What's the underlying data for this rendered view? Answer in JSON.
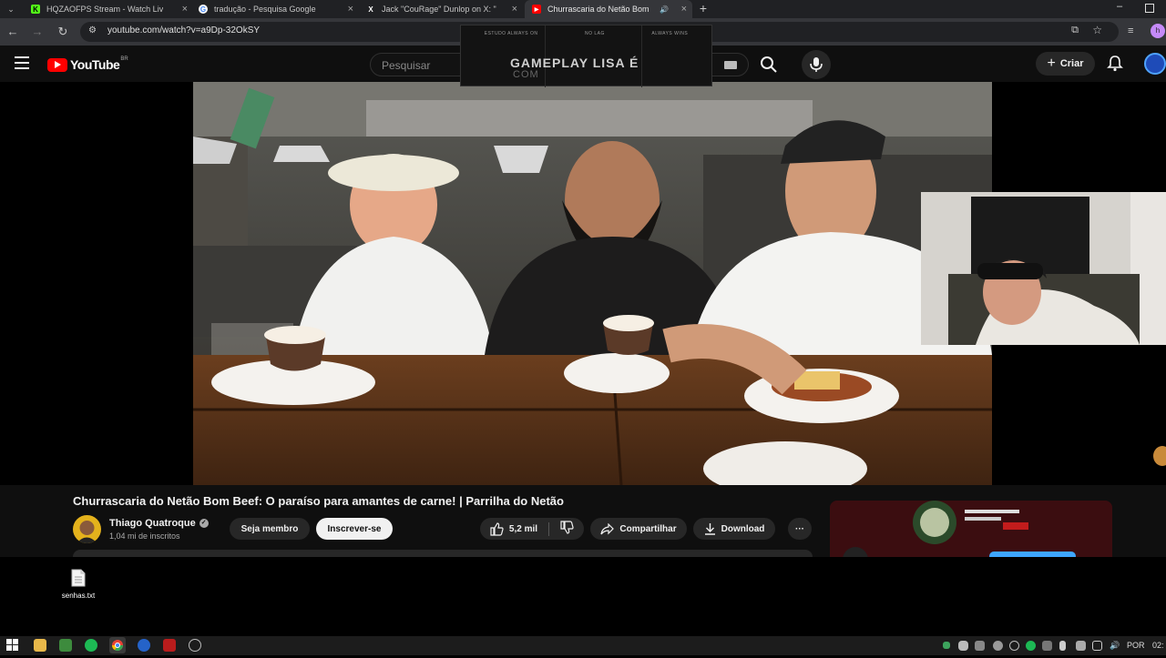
{
  "browser": {
    "tabs": [
      {
        "title": "HQZAOFPS Stream - Watch Liv",
        "icon": "kick-icon",
        "color": "#53fc18",
        "glyph": "K"
      },
      {
        "title": "tradução - Pesquisa Google",
        "icon": "google-icon",
        "color": "#ffffff",
        "glyph": "G"
      },
      {
        "title": "Jack \"CouRage\" Dunlop on X: \"",
        "icon": "x-icon",
        "color": "#ffffff",
        "glyph": "X"
      },
      {
        "title": "Churrascaria do Netão Bom",
        "icon": "youtube-icon",
        "color": "#ff0000",
        "glyph": "▶",
        "active": true
      }
    ],
    "url": "youtube.com/watch?v=a9Dp-32OkSY"
  },
  "youtube": {
    "logo_text": "YouTube",
    "region": "BR",
    "search_placeholder": "Pesquisar",
    "create_label": "Criar"
  },
  "overlay": {
    "columns": [
      "ESTUDO ALWAYS ON",
      "NO LAG",
      "ALWAYS WINS"
    ],
    "title": "GAMEPLAY LISA É",
    "subtitle": "COM"
  },
  "video": {
    "title": "Churrascaria do Netão Bom Beef: O paraíso para amantes de carne! | Parrilha do Netão",
    "channel": "Thiago Quatroque",
    "subscribers": "1,04 mi de inscritos",
    "join_label": "Seja membro",
    "subscribe_label": "Inscrever-se",
    "likes": "5,2 mil",
    "share_label": "Compartilhar",
    "download_label": "Download",
    "more_label": "···"
  },
  "desktop": {
    "file_label": "senhas.txt"
  },
  "taskbar": {
    "language": "POR",
    "time": "02:"
  },
  "colors": {
    "youtube_red": "#ff0000",
    "accent_blue": "#3ea6ff"
  }
}
